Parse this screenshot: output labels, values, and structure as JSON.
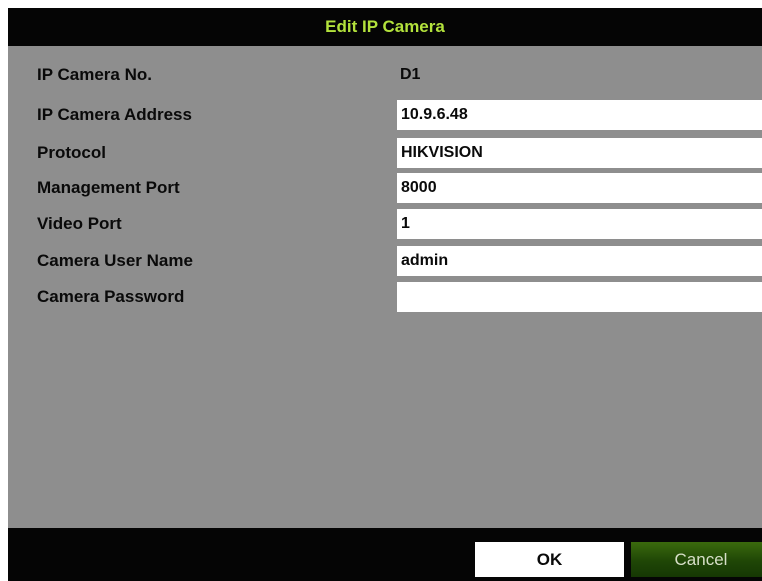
{
  "dialog": {
    "title": "Edit IP Camera"
  },
  "fields": {
    "camera_no": {
      "label": "IP Camera No.",
      "value": "D1"
    },
    "address": {
      "label": "IP Camera Address",
      "value": "10.9.6.48"
    },
    "protocol": {
      "label": "Protocol",
      "value": "HIKVISION"
    },
    "management_port": {
      "label": "Management Port",
      "value": "8000"
    },
    "video_port": {
      "label": "Video Port",
      "value": "1"
    },
    "user_name": {
      "label": "Camera User Name",
      "value": "admin"
    },
    "password": {
      "label": "Camera Password",
      "value": ""
    }
  },
  "buttons": {
    "ok": "OK",
    "cancel": "Cancel"
  },
  "colors": {
    "title_text": "#b3e23c",
    "panel_bg": "#8e8e8e",
    "bar_bg": "#050505",
    "cancel_bg": "#1f4606"
  }
}
